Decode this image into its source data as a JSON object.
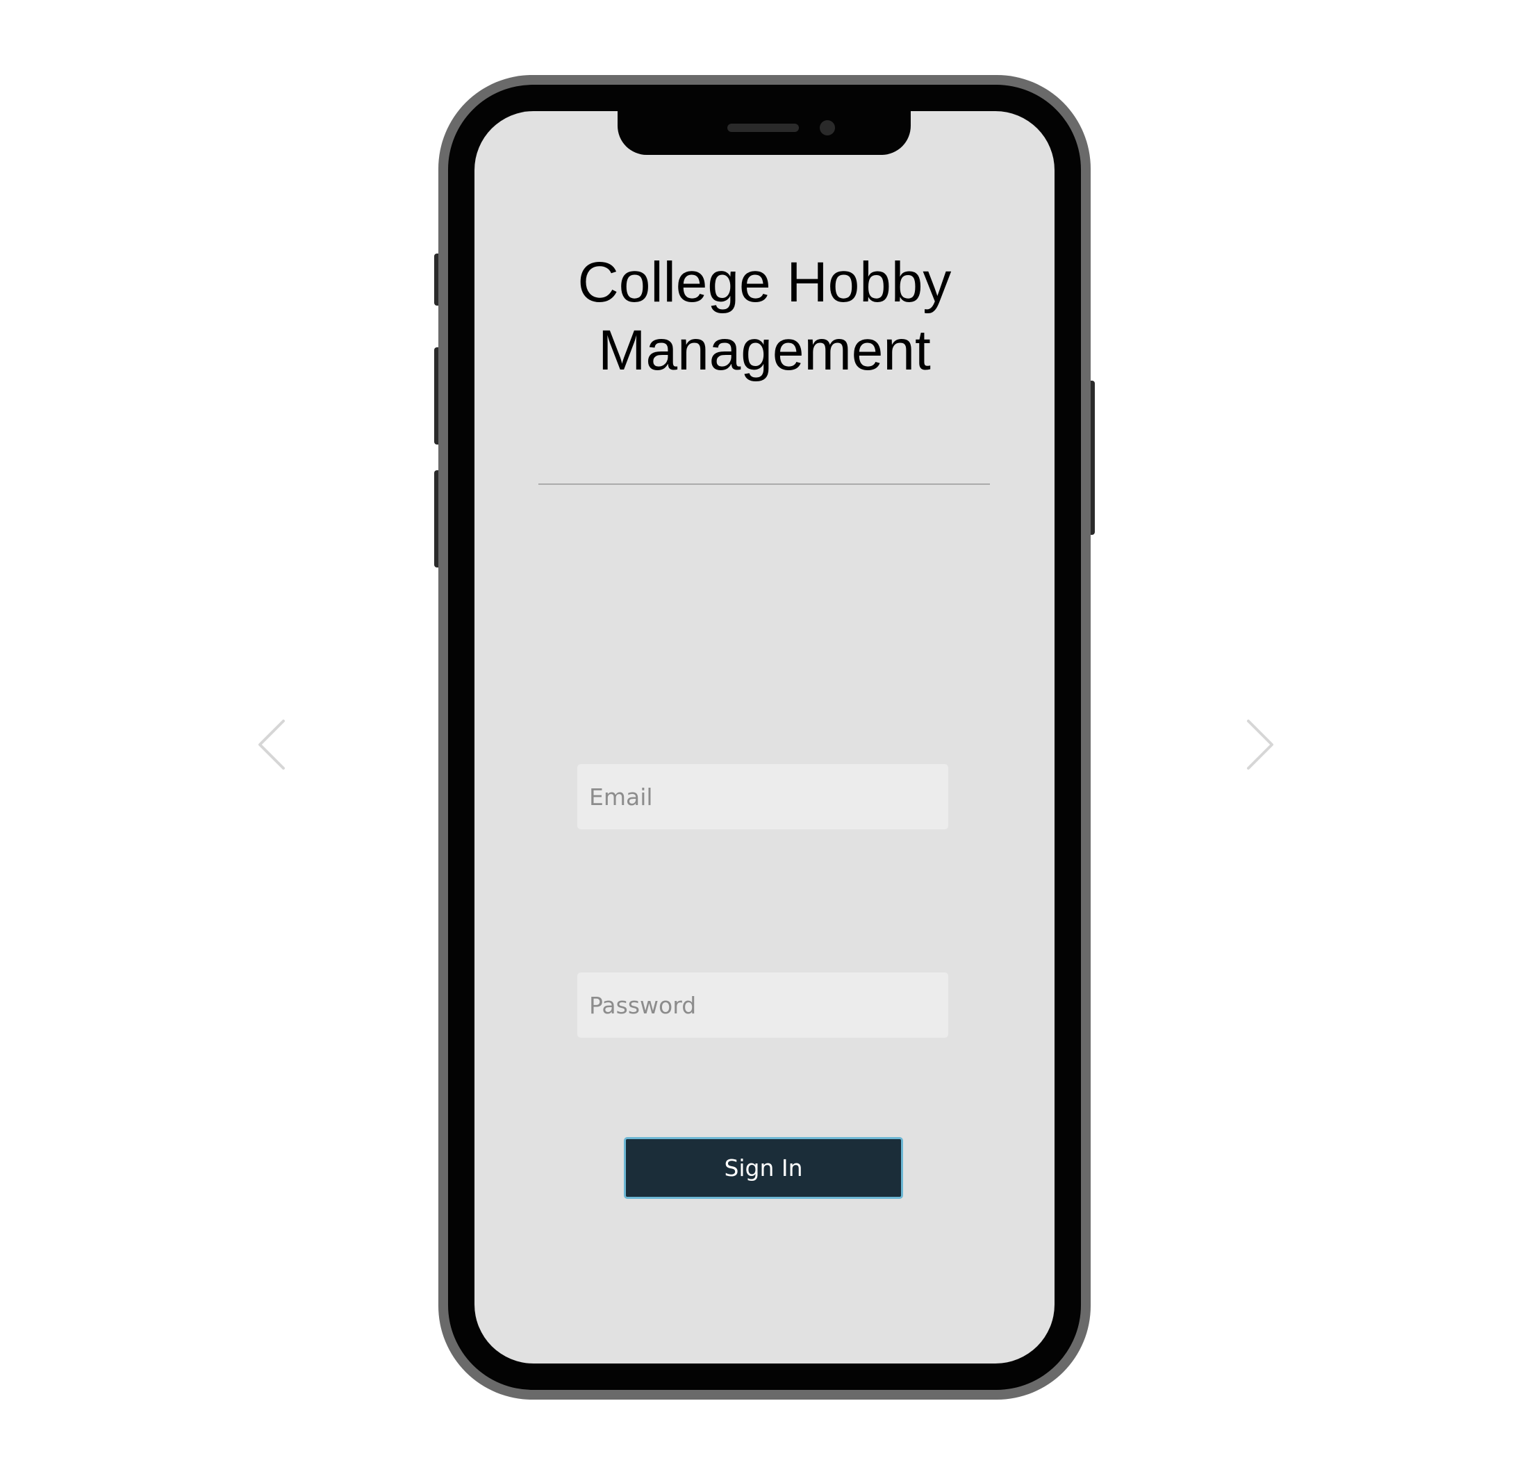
{
  "app": {
    "title": "College Hobby Management"
  },
  "login_form": {
    "email_placeholder": "Email",
    "email_value": "",
    "password_placeholder": "Password",
    "password_value": "",
    "sign_in_label": "Sign In"
  },
  "carousel": {
    "prev_icon": "chevron-left-icon",
    "next_icon": "chevron-right-icon"
  },
  "colors": {
    "screen_background": "#e1e1e1",
    "button_background": "#1b2d39",
    "button_border": "#6db7d4",
    "input_background": "#ececec"
  }
}
